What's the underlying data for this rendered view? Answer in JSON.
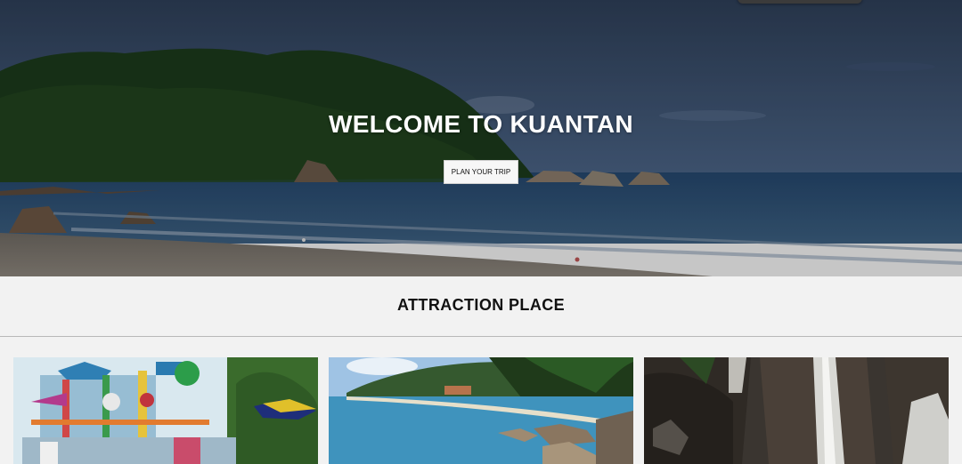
{
  "hero": {
    "title": "WELCOME TO KUANTAN",
    "button_label": "PLAN YOUR TRIP"
  },
  "attractions": {
    "heading": "ATTRACTION PLACE",
    "cards": [
      {
        "image_icon": "water-park-photo"
      },
      {
        "image_icon": "beach-bay-photo"
      },
      {
        "image_icon": "waterfall-photo"
      }
    ]
  }
}
